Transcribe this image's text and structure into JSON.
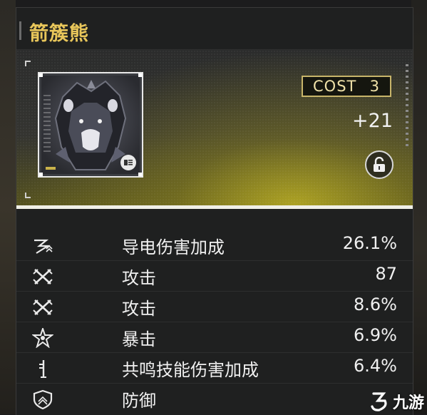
{
  "card": {
    "title": "箭簇熊",
    "cost_label": "COST",
    "cost_value": "3",
    "level": "+21",
    "lock_state": "unlocked"
  },
  "stats": [
    {
      "icon": "electro-damage-icon",
      "label": "导电伤害加成",
      "value": "26.1%"
    },
    {
      "icon": "attack-icon",
      "label": "攻击",
      "value": "87"
    },
    {
      "icon": "attack-icon",
      "label": "攻击",
      "value": "8.6%"
    },
    {
      "icon": "crit-icon",
      "label": "暴击",
      "value": "6.9%"
    },
    {
      "icon": "resonance-skill-icon",
      "label": "共鸣技能伤害加成",
      "value": "6.4%"
    },
    {
      "icon": "defense-icon",
      "label": "防御",
      "value": ""
    }
  ],
  "watermark": {
    "text": "九游"
  },
  "colors": {
    "title": "#e8c65a",
    "cost_border": "#c8b56a",
    "hero_glow": "#bcb024",
    "text": "#f0f0f0"
  }
}
